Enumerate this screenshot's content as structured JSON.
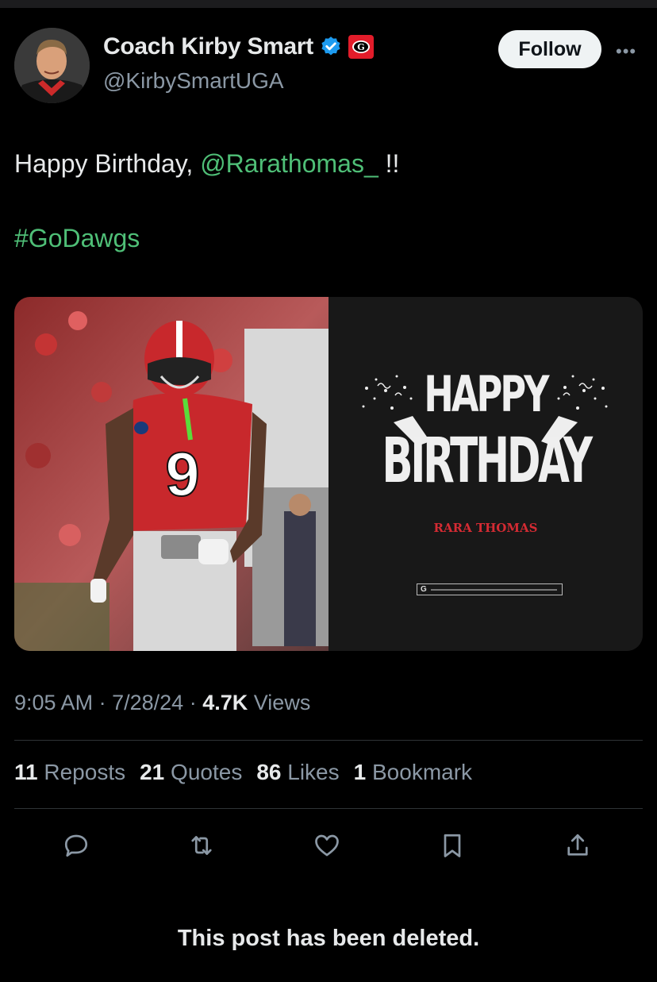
{
  "author": {
    "name": "Coach Kirby Smart",
    "handle": "@KirbySmartUGA",
    "affiliate_logo_letter": "G",
    "follow_label": "Follow",
    "more_label": "•••"
  },
  "tweet": {
    "text_before": "Happy Birthday, ",
    "mention": "@Rarathomas_",
    "text_after": " !!",
    "hashtag": "#GoDawgs"
  },
  "media": {
    "jersey_number": "9",
    "graphic_line1": "HAPPY",
    "graphic_line2": "BIRTHDAY",
    "player_name": "RARA THOMAS",
    "sponsor_logo": "G"
  },
  "meta": {
    "time": "9:05 AM",
    "date": "7/28/24",
    "views_count": "4.7K",
    "views_label": "Views",
    "sep": "·"
  },
  "stats": [
    {
      "count": "11",
      "label": "Reposts"
    },
    {
      "count": "21",
      "label": "Quotes"
    },
    {
      "count": "86",
      "label": "Likes"
    },
    {
      "count": "1",
      "label": "Bookmark"
    }
  ],
  "colors": {
    "background": "#000000",
    "link": "#4fbf77",
    "secondary_text": "#8b98a5",
    "verified": "#1d9bf0",
    "brand_red": "#e21c2a"
  },
  "actions": [
    "reply-icon",
    "repost-icon",
    "like-icon",
    "bookmark-icon",
    "share-icon"
  ],
  "notice": "This post has been deleted."
}
